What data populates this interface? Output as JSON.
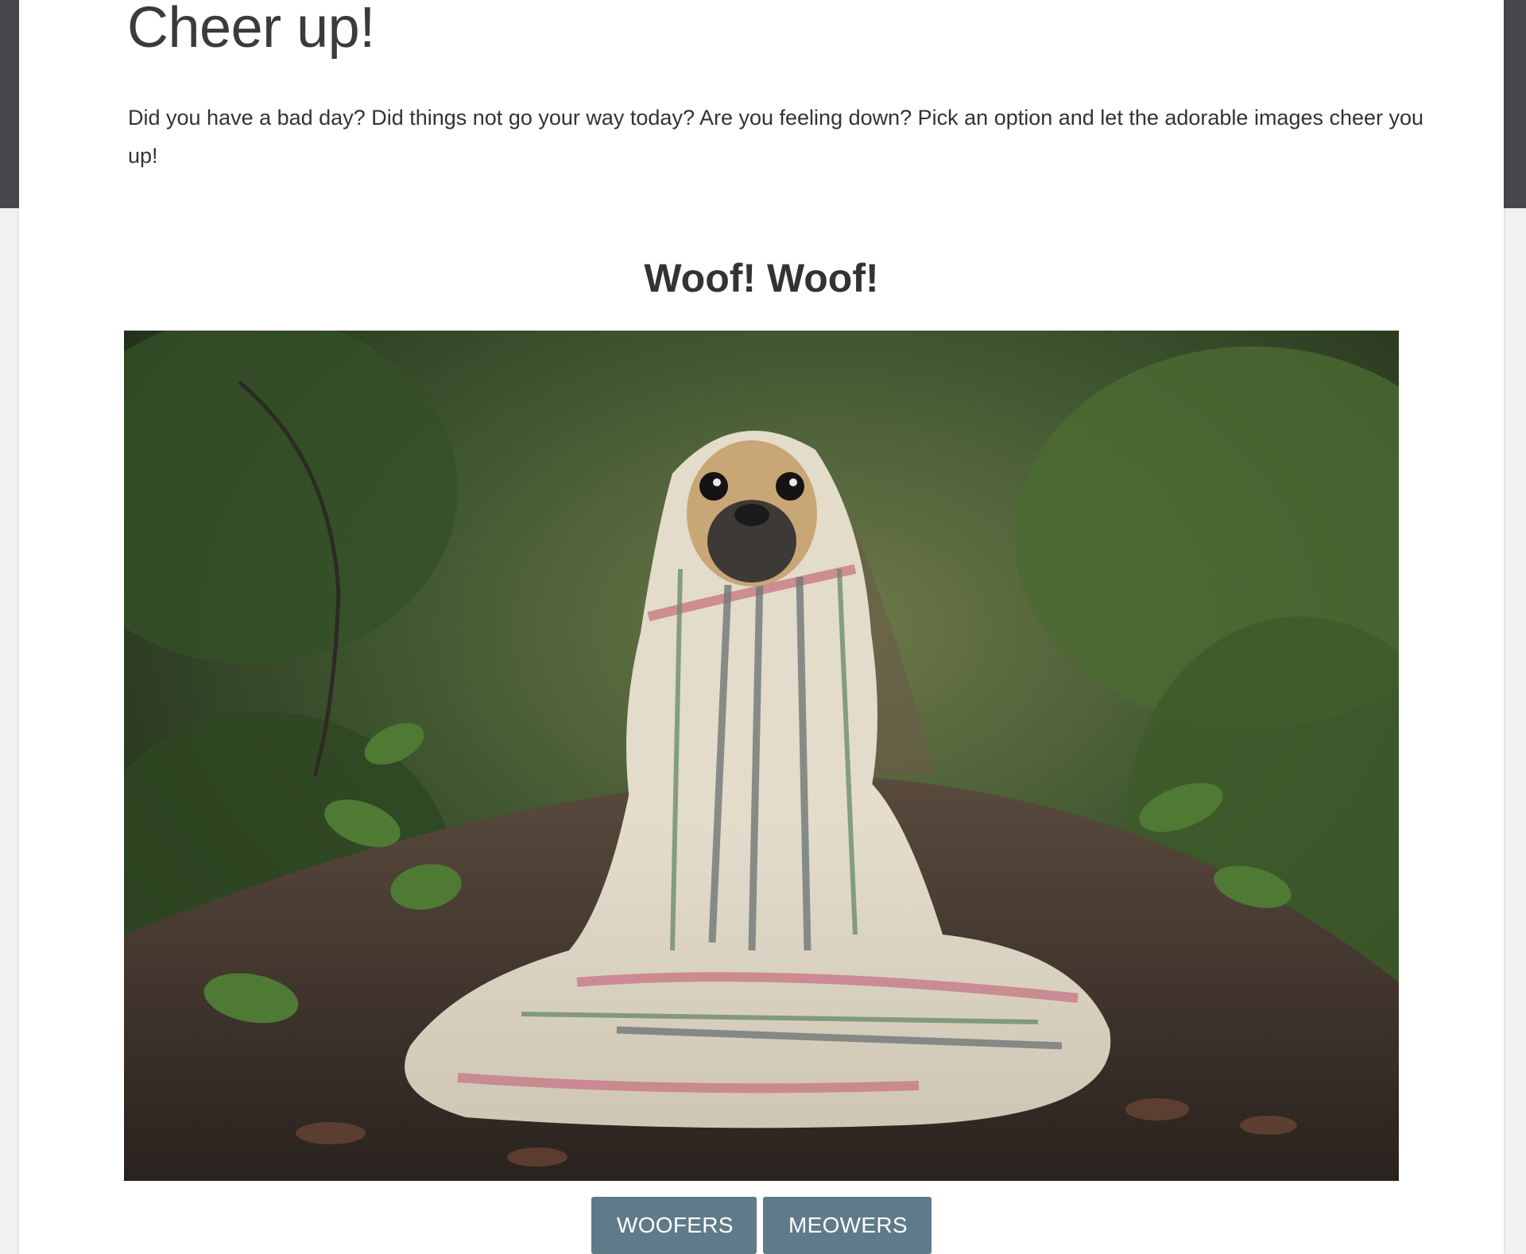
{
  "page": {
    "title": "Cheer up!",
    "intro": "Did you have a bad day? Did things not go your way today? Are you feeling down? Pick an option and let the adorable images cheer you up!"
  },
  "section": {
    "title": "Woof! Woof!"
  },
  "image": {
    "subject": "pug wrapped in plaid blanket on forest path"
  },
  "buttons": {
    "woofers": "WOOFERS",
    "meowers": "MEOWERS"
  },
  "colors": {
    "header_band": "#46474b",
    "button": "#5f7b89",
    "text": "#333335"
  }
}
